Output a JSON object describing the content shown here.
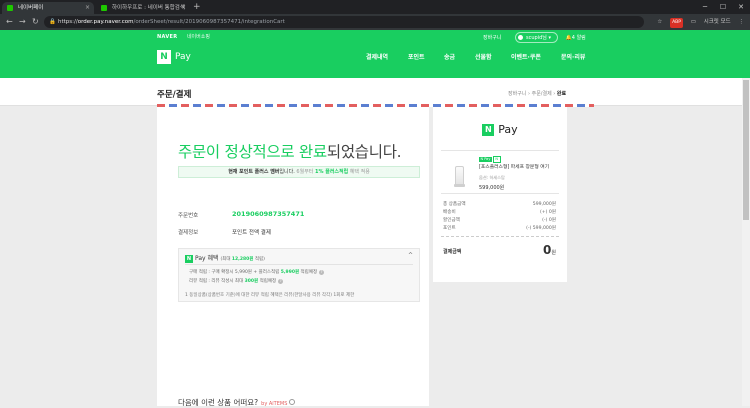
{
  "browser": {
    "tabs": [
      {
        "title": "네이버페이",
        "close": "×",
        "active": true
      },
      {
        "title": "하이하우프로 : 네이버 통합검색",
        "close": "×",
        "active": false
      }
    ],
    "new_tab": "+",
    "window": {
      "min": "─",
      "max": "☐",
      "close": "✕"
    },
    "nav": {
      "back": "←",
      "forward": "→",
      "reload": "↻"
    },
    "url": {
      "lock": "🔒",
      "scheme": "https://",
      "host": "order.pay.naver.com",
      "path": "/orderSheet/result/2019060987357471/integrationCart"
    },
    "extensions": {
      "star": "☆",
      "badge": "ABP",
      "cast": "▭",
      "profile": "시크릿 모드",
      "menu": "⋮"
    }
  },
  "header": {
    "naver_logo": "NAVER",
    "shopping": "네이버쇼핑",
    "cart_link": "장바구니",
    "user_name": "scupid",
    "user_suffix": "님 ▾",
    "alerts": "알림",
    "alerts_count": "4",
    "logo_n": "N",
    "logo_text": "Pay",
    "menu": [
      "결제내역",
      "포인트",
      "송금",
      "선물함",
      "이벤트·쿠폰",
      "문의·리뷰"
    ]
  },
  "subheader": {
    "page_title": "주문/결제",
    "steps": {
      "cart": "장바구니",
      "sep1": "›",
      "order": "주문/결제",
      "sep2": "›",
      "done": "완료"
    }
  },
  "result": {
    "headline_green": "주문이 정상적으로 완료",
    "headline_rest": "되었습니다.",
    "point_bar": {
      "prefix": "현재 포인트 플러스 멤버",
      "mid": "입니다. ",
      "gray": "6월부터 ",
      "green": "1% 플러스적립",
      "suffix": " 혜택 적용"
    },
    "order_no_label": "주문번호",
    "order_no": "2019060987357471",
    "payment_label": "결제정보",
    "payment_value": "포인트 전액 결제",
    "benefit": {
      "n": "N",
      "title": "Pay 혜택",
      "sub_prefix": "(최대 ",
      "sub_value": "12,280원",
      "sub_suffix": " 적립)",
      "chevron": "^",
      "line1_prefix": "구매 적립 : 구매 확정시 5,990원 + 플러스적립 ",
      "line1_green": "5,990원",
      "line1_suffix": " 적립예정",
      "line2_prefix": "리뷰 적립 : 리뷰 작성시 최대 ",
      "line2_green": "300원",
      "line2_suffix": " 적립예정",
      "help": "?"
    },
    "footnote": "1 동일상품(상품번호 기준)에 대한 리뷰 적립 혜택은 리뷰(한달사용 리뷰 각각) 1회로 제한",
    "related_title": "다음에 이런 상품 어떠요?",
    "related_badge": "by AiTEMS"
  },
  "summary": {
    "logo_n": "N",
    "logo_text": "Pay",
    "product": {
      "badges": [
        "N Pay",
        "N"
      ],
      "name": "[포스플러스형] 파세프 창문형 여기",
      "option": "옵션: 하세스탑",
      "price": "599,000원"
    },
    "rows": [
      {
        "label": "총 상품금액",
        "value": "599,000원"
      },
      {
        "label": "배송비",
        "value": "(+) 0원"
      },
      {
        "label": "할인금액",
        "value": "(-) 0원"
      },
      {
        "label": "포인트",
        "value": "(-) 599,000원"
      }
    ],
    "total_label": "결제금액",
    "total_value": "0",
    "total_unit": "원"
  },
  "colors": {
    "brand": "#19ce60",
    "accent_red": "#e35f5f",
    "accent_blue": "#5b7fd1"
  }
}
